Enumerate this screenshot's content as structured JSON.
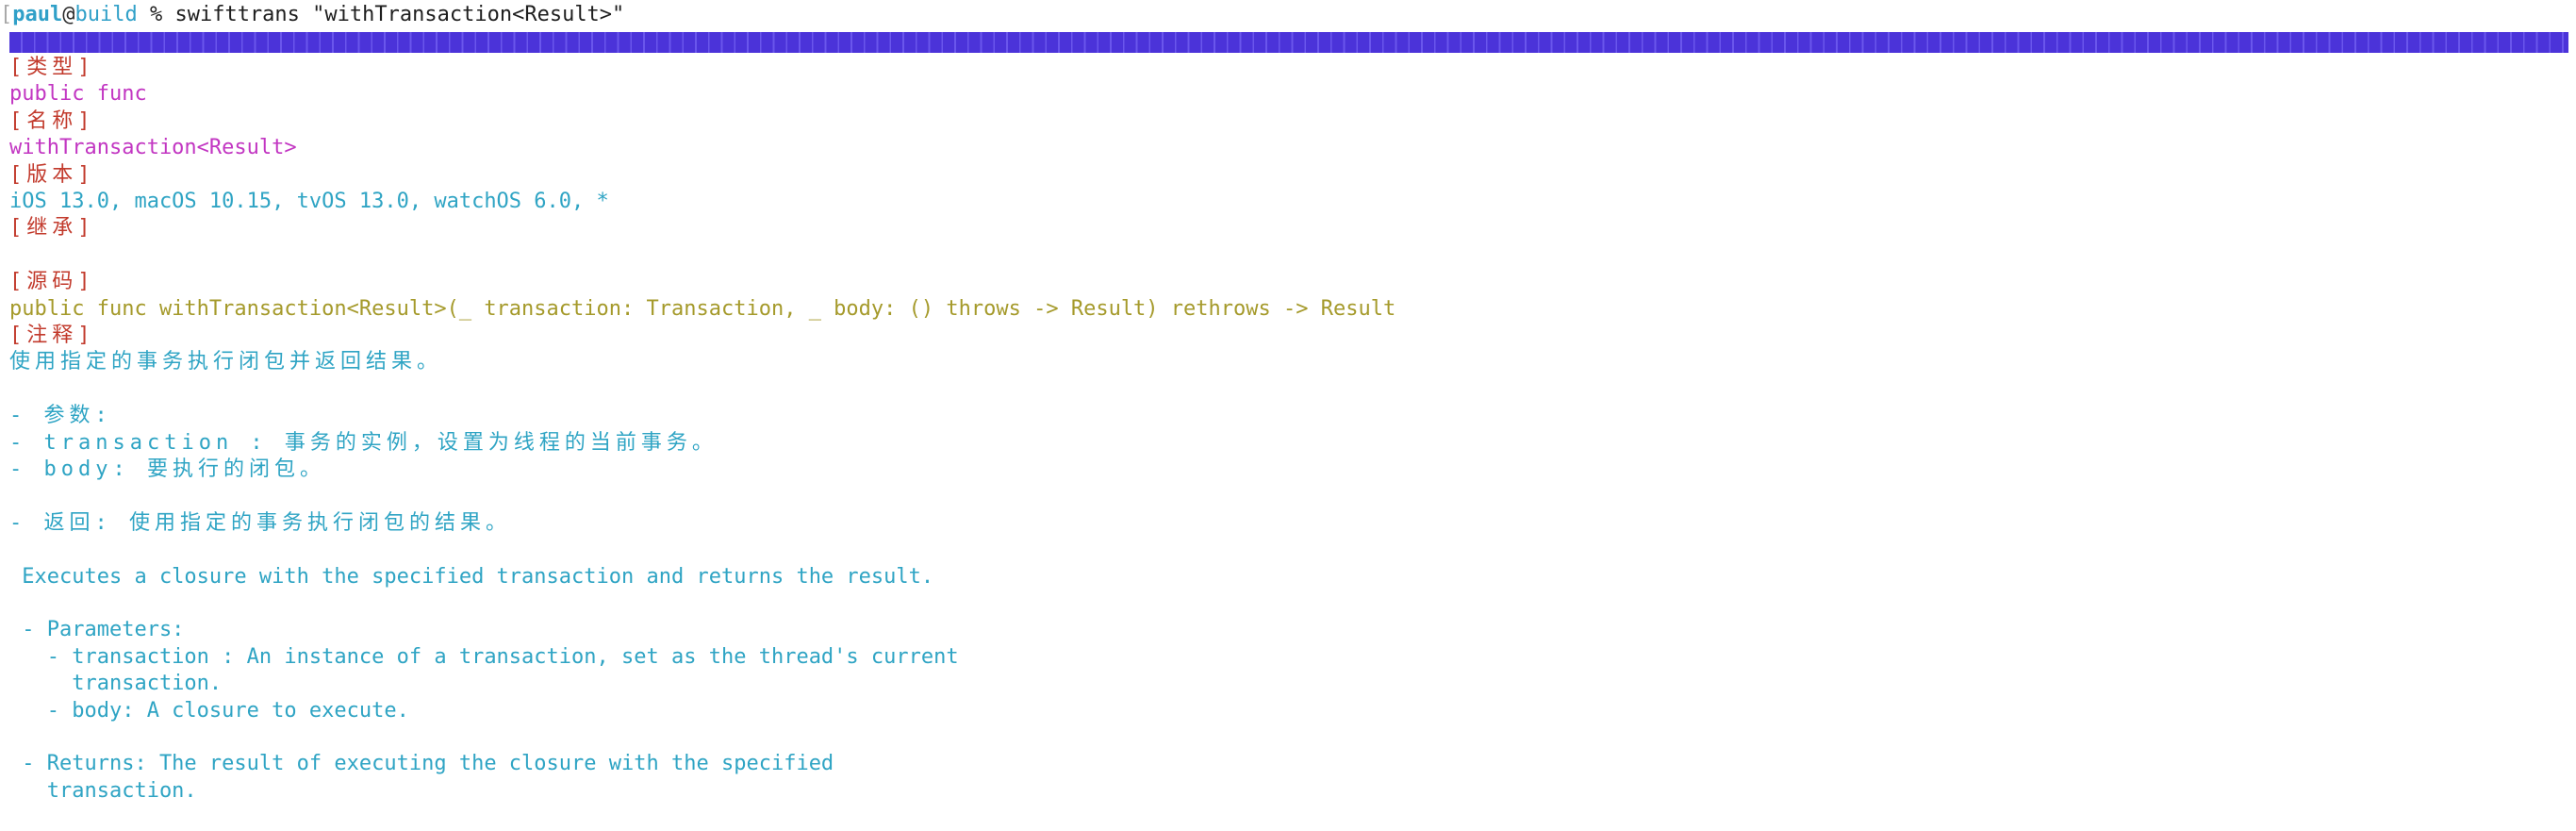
{
  "prompt": {
    "open_bracket": "[",
    "user": "paul",
    "at": "@",
    "host": "build",
    "symbol": " % ",
    "command": "swifttrans \"withTransaction<Result>\""
  },
  "progress": {
    "fraction": 1.0,
    "color": "#4b33d9"
  },
  "sections": {
    "type_header": "[类型]",
    "type_value": "public func",
    "name_header": "[名称]",
    "name_value": "withTransaction<Result>",
    "version_header": "[版本]",
    "version_value": "iOS 13.0, macOS 10.15, tvOS 13.0, watchOS 6.0, *",
    "inherit_header": "[继承]",
    "source_header": "[源码]",
    "source_value": "public func withTransaction<Result>(_ transaction: Transaction, _ body: () throws -> Result) rethrows -> Result",
    "note_header": "[注释]"
  },
  "note_cn": {
    "summary": "使用指定的事务执行闭包并返回结果。",
    "params_title": "- 参数:",
    "param_transaction": "- transaction : 事务的实例，设置为线程的当前事务。",
    "param_body": "- body: 要执行的闭包。",
    "returns": "- 返回: 使用指定的事务执行闭包的结果。"
  },
  "note_en": {
    "summary": " Executes a closure with the specified transaction and returns the result.",
    "params_title": " - Parameters:",
    "param_transaction_1": "   - transaction : An instance of a transaction, set as the thread's current",
    "param_transaction_2": "     transaction.",
    "param_body": "   - body: A closure to execute.",
    "returns_1": " - Returns: The result of executing the closure with the specified",
    "returns_2": "   transaction."
  }
}
